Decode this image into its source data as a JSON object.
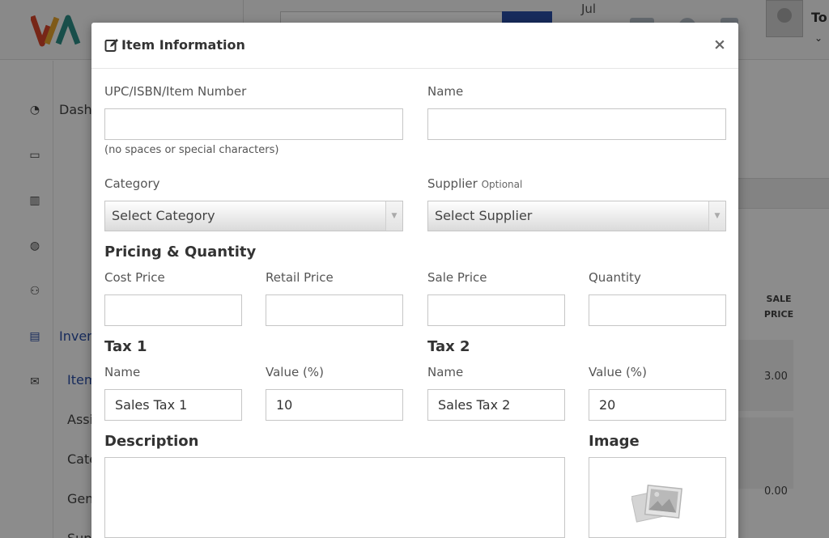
{
  "background": {
    "header": {
      "date_fragment": "Jul",
      "username_fragment": "To"
    },
    "sidebar": {
      "items": [
        {
          "label": "Dash",
          "icon": "dashboard-icon"
        },
        {
          "label": "",
          "icon": "monitor-icon"
        },
        {
          "label": "",
          "icon": "bar-chart-icon"
        },
        {
          "label": "",
          "icon": "globe-icon"
        },
        {
          "label": "",
          "icon": "users-icon"
        },
        {
          "label": "Inven",
          "icon": "list-icon"
        },
        {
          "label": "",
          "icon": "envelope-icon"
        }
      ],
      "subitems": [
        "Item",
        "Assi",
        "Cate",
        "Gen",
        "Sup"
      ]
    },
    "table": {
      "header": "SALE PRICE",
      "cells": [
        "3.00",
        "0.00"
      ]
    }
  },
  "modal": {
    "title": "Item Information",
    "title_icon": "edit-icon",
    "close_icon": "close-icon",
    "close_glyph": "×",
    "fields": {
      "upc": {
        "label": "UPC/ISBN/Item Number",
        "value": "",
        "help": "(no spaces or special characters)"
      },
      "name": {
        "label": "Name",
        "value": ""
      },
      "category": {
        "label": "Category",
        "selected": "Select Category"
      },
      "supplier": {
        "label": "Supplier",
        "optional": "Optional",
        "selected": "Select Supplier"
      }
    },
    "pricing": {
      "heading": "Pricing & Quantity",
      "cost_price": {
        "label": "Cost Price",
        "value": ""
      },
      "retail_price": {
        "label": "Retail Price",
        "value": ""
      },
      "sale_price": {
        "label": "Sale Price",
        "value": ""
      },
      "quantity": {
        "label": "Quantity",
        "value": ""
      }
    },
    "tax1": {
      "heading": "Tax 1",
      "name_label": "Name",
      "name_value": "Sales Tax 1",
      "value_label": "Value (%)",
      "value": "10"
    },
    "tax2": {
      "heading": "Tax 2",
      "name_label": "Name",
      "name_value": "Sales Tax 2",
      "value_label": "Value (%)",
      "value": "20"
    },
    "description": {
      "heading": "Description",
      "value": ""
    },
    "image": {
      "heading": "Image",
      "icon": "image-placeholder-icon"
    }
  },
  "colors": {
    "accent": "#2a4fa8",
    "overlay": "rgba(0,0,0,0.45)"
  }
}
